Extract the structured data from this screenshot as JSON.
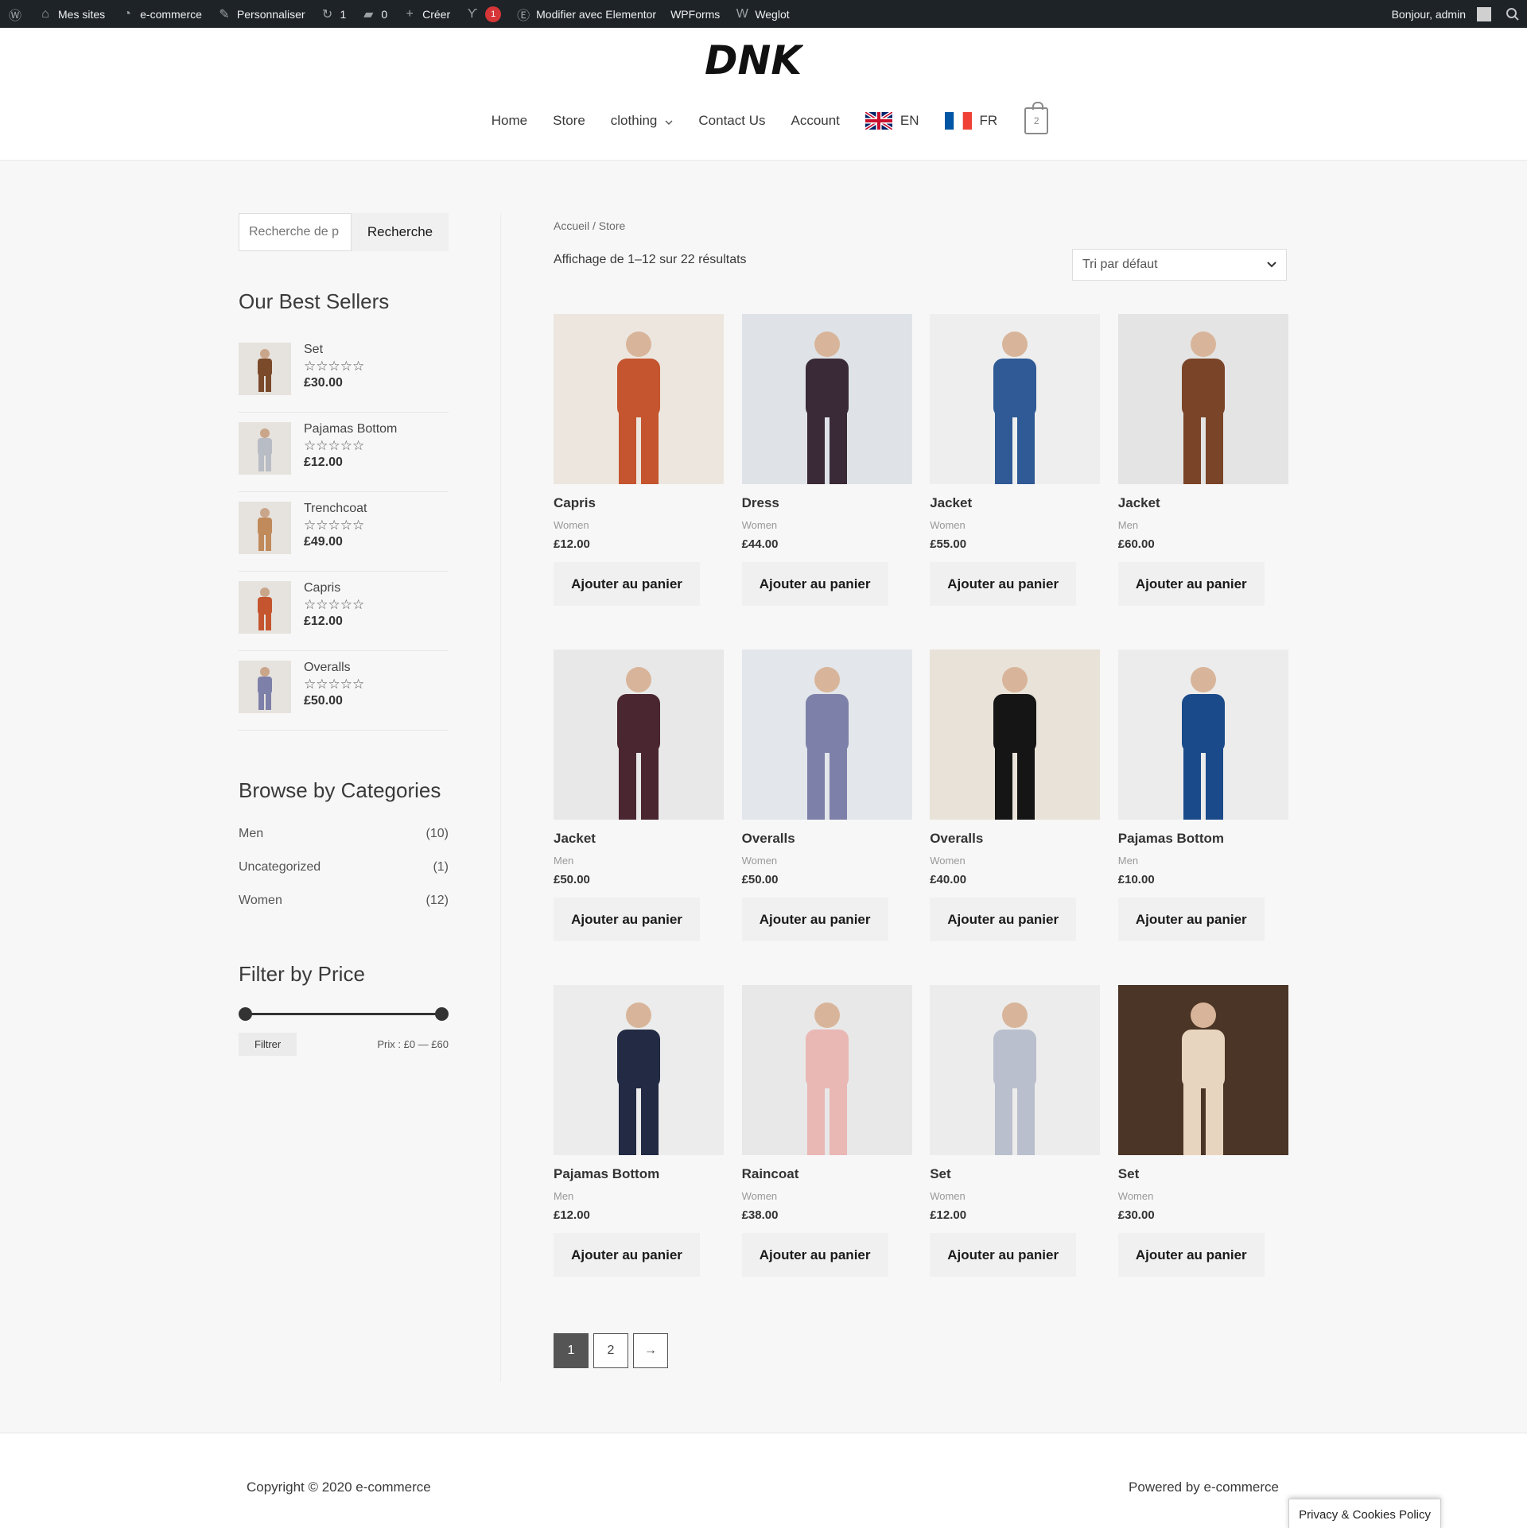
{
  "admin_bar": {
    "items": [
      {
        "label": "",
        "icon": "wordpress-icon"
      },
      {
        "label": "Mes sites",
        "icon": "sites-icon"
      },
      {
        "label": "e-commerce",
        "icon": "dashboard-icon"
      },
      {
        "label": "Personnaliser",
        "icon": "brush-icon"
      },
      {
        "label": "1",
        "icon": "updates-icon"
      },
      {
        "label": "0",
        "icon": "comments-icon"
      },
      {
        "label": "Créer",
        "icon": "plus-icon"
      },
      {
        "label": "1",
        "icon": "yoast-icon",
        "badge": true
      },
      {
        "label": "Modifier avec Elementor",
        "icon": "elementor-icon"
      },
      {
        "label": "WPForms",
        "icon": ""
      },
      {
        "label": "Weglot",
        "icon": "weglot-icon"
      }
    ],
    "greeting": "Bonjour, admin"
  },
  "header": {
    "logo_text": "DNK",
    "nav": [
      {
        "label": "Home"
      },
      {
        "label": "Store"
      },
      {
        "label": "clothing",
        "dropdown": true
      },
      {
        "label": "Contact Us"
      },
      {
        "label": "Account"
      }
    ],
    "lang_en": "EN",
    "lang_fr": "FR",
    "cart_count": "2"
  },
  "sidebar": {
    "search_placeholder": "Recherche de p",
    "search_button": "Recherche",
    "best_sellers_title": "Our Best Sellers",
    "best_sellers": [
      {
        "name": "Set",
        "stars": "☆☆☆☆☆",
        "price": "£30.00",
        "color": "#7a4a2a"
      },
      {
        "name": "Pajamas Bottom",
        "stars": "☆☆☆☆☆",
        "price": "£12.00",
        "color": "#b8bcc4"
      },
      {
        "name": "Trenchcoat",
        "stars": "☆☆☆☆☆",
        "price": "£49.00",
        "color": "#c08a5a"
      },
      {
        "name": "Capris",
        "stars": "☆☆☆☆☆",
        "price": "£12.00",
        "color": "#c4552e"
      },
      {
        "name": "Overalls",
        "stars": "☆☆☆☆☆",
        "price": "£50.00",
        "color": "#7d80a8"
      }
    ],
    "categories_title": "Browse by Categories",
    "categories": [
      {
        "name": "Men",
        "count": "(10)"
      },
      {
        "name": "Uncategorized",
        "count": "(1)"
      },
      {
        "name": "Women",
        "count": "(12)"
      }
    ],
    "filter_title": "Filter by Price",
    "filter_button": "Filtrer",
    "price_label": "Prix : £0 — £60"
  },
  "main": {
    "breadcrumb": "Accueil / Store",
    "result_count": "Affichage de 1–12 sur 22 résultats",
    "sort_selected": "Tri par défaut",
    "add_to_cart": "Ajouter au panier",
    "products": [
      {
        "title": "Capris",
        "category": "Women",
        "price": "£12.00",
        "bg": "#ece6df",
        "fg": "#c4552e"
      },
      {
        "title": "Dress",
        "category": "Women",
        "price": "£44.00",
        "bg": "#dfe3e7",
        "fg": "#3a2a38"
      },
      {
        "title": "Jacket",
        "category": "Women",
        "price": "£55.00",
        "bg": "#eeeeee",
        "fg": "#2f5a95"
      },
      {
        "title": "Jacket",
        "category": "Men",
        "price": "£60.00",
        "bg": "#e4e4e4",
        "fg": "#7a4428"
      },
      {
        "title": "Jacket",
        "category": "Men",
        "price": "£50.00",
        "bg": "#e8e8e8",
        "fg": "#4a2630"
      },
      {
        "title": "Overalls",
        "category": "Women",
        "price": "£50.00",
        "bg": "#e3e6ea",
        "fg": "#7d80a8"
      },
      {
        "title": "Overalls",
        "category": "Women",
        "price": "£40.00",
        "bg": "#e9e2d8",
        "fg": "#151515"
      },
      {
        "title": "Pajamas Bottom",
        "category": "Men",
        "price": "£10.00",
        "bg": "#ececec",
        "fg": "#1a4a8a"
      },
      {
        "title": "Pajamas Bottom",
        "category": "Men",
        "price": "£12.00",
        "bg": "#ececec",
        "fg": "#222a44"
      },
      {
        "title": "Raincoat",
        "category": "Women",
        "price": "£38.00",
        "bg": "#e8e8e8",
        "fg": "#e9b7b4"
      },
      {
        "title": "Set",
        "category": "Women",
        "price": "£12.00",
        "bg": "#ececec",
        "fg": "#b9bfcc"
      },
      {
        "title": "Set",
        "category": "Women",
        "price": "£30.00",
        "bg": "#4b3526",
        "fg": "#e8d5c0"
      }
    ],
    "pagination": [
      "1",
      "2",
      "→"
    ]
  },
  "footer": {
    "copyright": "Copyright © 2020 e-commerce",
    "powered": "Powered by e-commerce",
    "privacy": "Privacy & Cookies Policy"
  }
}
